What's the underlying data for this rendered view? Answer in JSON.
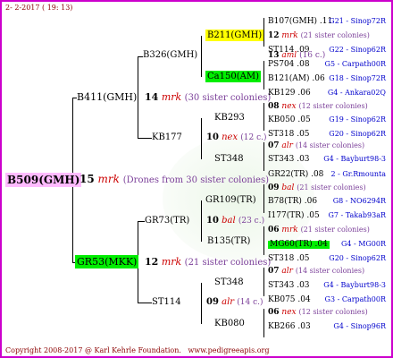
{
  "header": {
    "date": "2- 2-2017 ( 19: 13)"
  },
  "root": {
    "name": "B509(GMH)",
    "num": "15",
    "mark": "mrk",
    "sisters": "(Drones from 30 sister colonies)"
  },
  "sire": {
    "name": "B411(GMH)",
    "num": "14",
    "mark": "mrk",
    "sisters": "(30 sister colonies)"
  },
  "dam": {
    "name": "GR53(MKK)",
    "num": "12",
    "mark": "mrk",
    "sisters": "(21 sister colonies)"
  },
  "gen3": {
    "b326": {
      "name": "B326(GMH)"
    },
    "kb177": {
      "name": "KB177",
      "num": "10",
      "mark": "nex",
      "sisters": "(12 c.)"
    },
    "gr73": {
      "name": "GR73(TR)",
      "num": "10",
      "mark": "bal",
      "sisters": "(23 c.)"
    },
    "st114": {
      "name": "ST114",
      "num": "09",
      "mark": "alr",
      "sisters": "(14 c.)"
    }
  },
  "gen4": {
    "b211": {
      "name": "B211(GMH)",
      "num": "13",
      "mark": "aml",
      "sisters": "(16 c.)"
    },
    "ca150": {
      "name": "Ca150(AM)",
      "num": "11",
      "mark": "aml",
      "sisters": "(16 sister colonies)"
    },
    "kb293": {
      "name": "KB293"
    },
    "st348a": {
      "name": "ST348"
    },
    "gr109": {
      "name": "GR109(TR)"
    },
    "b135": {
      "name": "B135(TR)"
    },
    "st348b": {
      "name": "ST348"
    },
    "kb080": {
      "name": "KB080"
    }
  },
  "gen5": [
    {
      "name": "B107(GMH) .11",
      "group": "G21 - Sinop72R"
    },
    {
      "num": "12",
      "mark": "mrk",
      "sisters": "(21 sister colonies)"
    },
    {
      "name": "ST114 .09",
      "group": "G22 - Sinop62R"
    },
    {
      "name": "PS704 .08",
      "group": "G5 - Carpath00R"
    },
    {
      "name": "B121(AM) .06",
      "group": "G18 - Sinop72R"
    },
    {
      "name": "KB129 .06",
      "group": "G4 - Ankara02Q"
    },
    {
      "num": "08",
      "mark": "nex",
      "sisters": "(12 sister colonies)"
    },
    {
      "name": "KB050 .05",
      "group": "G19 - Sinop62R"
    },
    {
      "name": "ST318 .05",
      "group": "G20 - Sinop62R"
    },
    {
      "num": "07",
      "mark": "alr",
      "sisters": "(14 sister colonies)"
    },
    {
      "name": "ST343 .03",
      "group": "G4 - Bayburt98-3"
    },
    {
      "name": "GR22(TR) .08",
      "group": "2 - Gr.Rmounta"
    },
    {
      "num": "09",
      "mark": "bal",
      "sisters": "(21 sister colonies)"
    },
    {
      "name": "B78(TR) .06",
      "group": "G8 - NO6294R"
    },
    {
      "name": "I177(TR) .05",
      "group": "G7 - Takab93aR"
    },
    {
      "num": "06",
      "mark": "mrk",
      "sisters": "(21 sister colonies)"
    },
    {
      "name": "MG60(TR) .04",
      "group": "G4 - MG00R"
    },
    {
      "name": "ST318 .05",
      "group": "G20 - Sinop62R"
    },
    {
      "num": "07",
      "mark": "alr",
      "sisters": "(14 sister colonies)"
    },
    {
      "name": "ST343 .03",
      "group": "G4 - Bayburt98-3"
    },
    {
      "name": "KB075 .04",
      "group": "G3 - Carpath00R"
    },
    {
      "num": "06",
      "mark": "nex",
      "sisters": "(12 sister colonies)"
    },
    {
      "name": "KB266 .03",
      "group": "G4 - Sinop96R"
    }
  ],
  "footer": {
    "copyright": "Copyright 2008-2017 @ Karl Kehrle Foundation.",
    "site": "www.pedigreeapis.org"
  }
}
